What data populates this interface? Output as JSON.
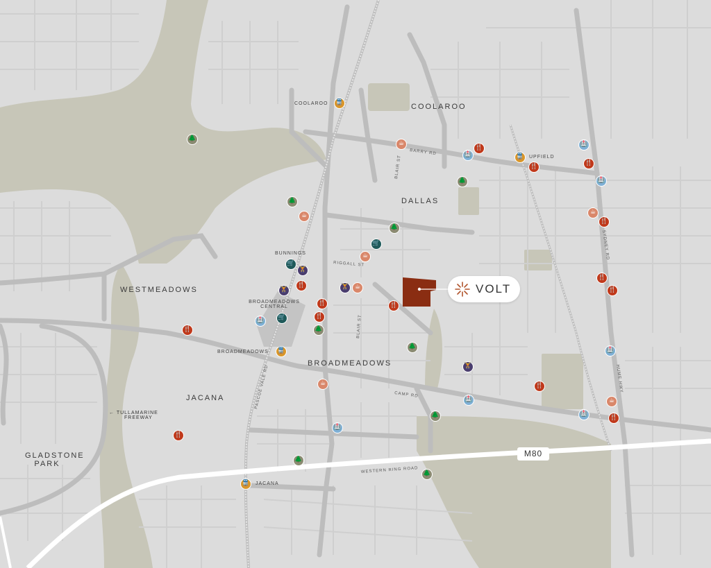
{
  "project": {
    "name": "VOLT"
  },
  "colors": {
    "land": "#dcdcdc",
    "green": "#c7c6b8",
    "road": "#bdbdbd",
    "major_road": "#ffffff",
    "site": "#8a2d12",
    "food": "#c0391b",
    "train": "#d9962a",
    "park": "#8b8b72",
    "shopping": "#1f5a5a",
    "gym": "#4a3d6e",
    "cafe": "#d9876a",
    "medical": "#7fb0d6"
  },
  "suburbs": {
    "coolaroo": "COOLAROO",
    "dallas": "DALLAS",
    "westmeadows": "WESTMEADOWS",
    "broadmeadows": "BROADMEADOWS",
    "jacana": "JACANA",
    "gladstone_park_line1": "GLADSTONE",
    "gladstone_park_line2": "PARK"
  },
  "places": {
    "coolaroo_station": "COOLAROO",
    "upfield_station": "UPFIELD",
    "bunnings": "BUNNINGS",
    "broadmeadows_central_line1": "BROADMEADOWS",
    "broadmeadows_central_line2": "CENTRAL",
    "broadmeadows_station": "BROADMEADOWS",
    "jacana_station": "JACANA",
    "tullamarine_arrow": "←",
    "tullamarine_line1": "TULLAMARINE",
    "tullamarine_line2": "FREEWAY"
  },
  "roads": {
    "barry_rd": "BARRY RD",
    "blair_st_north": "BLAIR ST",
    "blair_st_south": "BLAIR ST",
    "riggall_st": "RIGGALL ST",
    "camp_rd": "CAMP RD",
    "pascoe_vale_rd": "PASCOE VALE RD",
    "sydney_rd": "SYDNEY RD",
    "hume_hwy": "HUME HWY",
    "western_ring_road": "WESTERN RING ROAD",
    "m80": "M80"
  },
  "icons": {
    "food": "🍴",
    "train": "🚆",
    "park": "🌲",
    "shopping": "🛒",
    "gym": "🏋",
    "cafe": "☕",
    "medical": "🏥"
  }
}
